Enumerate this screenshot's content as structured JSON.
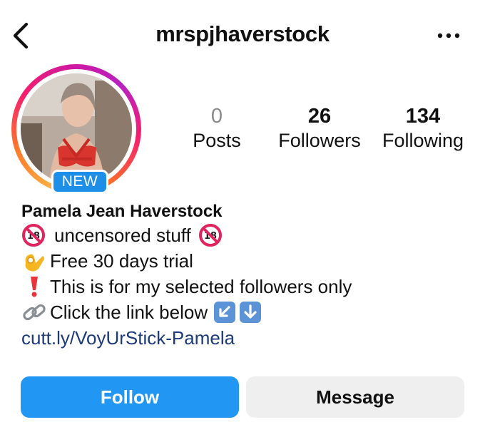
{
  "header": {
    "username": "mrspjhaverstock",
    "back_icon": "chevron-left-icon",
    "more_icon": "more-horizontal-icon"
  },
  "profile": {
    "story_ring_colors": [
      "#fcb045",
      "#f51f6e",
      "#b821c2"
    ],
    "new_badge": "NEW"
  },
  "stats": {
    "posts": {
      "value": "0",
      "label": "Posts"
    },
    "followers": {
      "value": "26",
      "label": "Followers"
    },
    "following": {
      "value": "134",
      "label": "Following"
    }
  },
  "bio": {
    "full_name": "Pamela Jean Haverstock",
    "lines": [
      {
        "icon": "no-under-18-icon",
        "text": "uncensored stuff",
        "trailing_icon": "no-under-18-icon"
      },
      {
        "icon": "ok-hand-icon",
        "text": "Free 30 days trial"
      },
      {
        "icon": "exclamation-icon",
        "text": "This is for my selected followers only"
      },
      {
        "icon": "link-icon",
        "text": "Click the link below",
        "trailing_icons": [
          "arrow-down-left-icon",
          "arrow-down-icon"
        ]
      }
    ],
    "link": "cutt.ly/VoyUrStick-Pamela",
    "link_color": "#1d3a7a"
  },
  "actions": {
    "follow_label": "Follow",
    "message_label": "Message",
    "follow_color": "#2196f3"
  }
}
